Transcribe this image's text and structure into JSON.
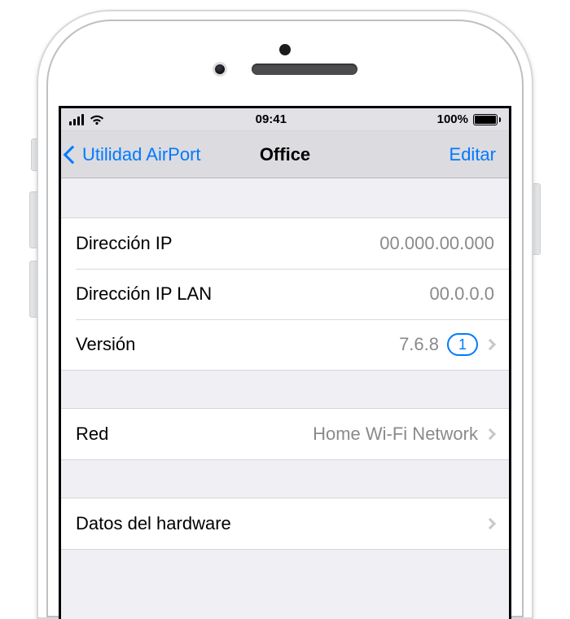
{
  "status": {
    "time": "09:41",
    "battery_label": "100%"
  },
  "nav": {
    "back_label": "Utilidad AirPort",
    "title": "Office",
    "edit_label": "Editar"
  },
  "sections": {
    "info": {
      "ip_label": "Dirección IP",
      "ip_value": "00.000.00.000",
      "lan_label": "Dirección IP LAN",
      "lan_value": "00.0.0.0",
      "version_label": "Versión",
      "version_value": "7.6.8",
      "version_badge": "1"
    },
    "network": {
      "label": "Red",
      "value": "Home Wi-Fi Network"
    },
    "hardware": {
      "label": "Datos del hardware"
    }
  }
}
